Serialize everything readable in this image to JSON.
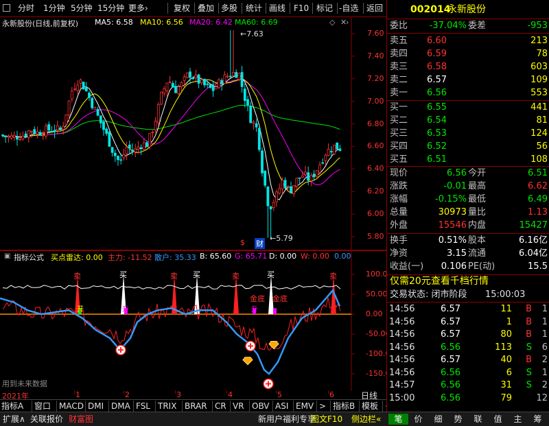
{
  "toolbar": {
    "left": [
      "分时",
      "1分钟",
      "5分钟",
      "15分钟",
      "更多›"
    ],
    "right": [
      "复权",
      "叠加",
      "多股",
      "统计",
      "画线",
      "F10",
      "标记",
      "-自选",
      "返回"
    ]
  },
  "main": {
    "title": "永新股份(日线,前复权)",
    "ma5": "MA5: 6.58",
    "ma10": "MA10: 6.56",
    "ma20": "MA20: 6.42",
    "ma60": "MA60: 6.69",
    "y_ticks": [
      "7.60",
      "7.40",
      "7.20",
      "7.00",
      "6.80",
      "6.60",
      "6.40",
      "6.20",
      "6.00",
      "5.80"
    ],
    "high_mark": "7.63",
    "low_mark": "5.79",
    "cai_label": "财",
    "dollar_label": "$"
  },
  "indicator": {
    "name": "指标公式",
    "buy_radar": "买点雷达: 0.00",
    "main_force": "主力: -11.52",
    "retail": "散户: 35.33",
    "b": "B: 65.60",
    "g": "G: 65.71",
    "d": "D: 0.00",
    "w": "W: 0.00",
    "extra": "0.00",
    "y_ticks": [
      "100.0",
      "50.00",
      "0.00",
      "-50.00",
      "-100.0",
      "-150.0"
    ],
    "marks": {
      "sell": "卖",
      "buy": "买",
      "gold_bottom": "金底",
      "kai": "开",
      "up": "升"
    },
    "future_warning": "用到未来数据"
  },
  "xaxis": {
    "year": "2021年",
    "months": [
      "1",
      "2",
      "3",
      "4",
      "5",
      "6"
    ],
    "period": "日线"
  },
  "tabs1": [
    "指标A",
    "窗口",
    "MACD",
    "DMI",
    "DMA",
    "FSL",
    "TRIX",
    "BRAR",
    "CR",
    "VR",
    "OBV",
    "ASI",
    "EMV",
    ">",
    "指标B",
    "模板",
    "+",
    "-"
  ],
  "tabs2": {
    "left": [
      "扩展∧",
      "关联报价",
      "财富图"
    ],
    "mid": [
      "新用户福利专享",
      "图文F10",
      "侧边栏«"
    ],
    "right": [
      "笔",
      "价",
      "细",
      "势",
      "联",
      "值",
      "主",
      "筹"
    ]
  },
  "quote": {
    "code": "002014",
    "name": "永新股份",
    "weibi_label": "委比",
    "weibi": "-37.04%",
    "weicha_label": "委差",
    "weicha": "-953",
    "asks": [
      {
        "label": "卖五",
        "price": "6.60",
        "vol": "213"
      },
      {
        "label": "卖四",
        "price": "6.59",
        "vol": "78"
      },
      {
        "label": "卖三",
        "price": "6.58",
        "vol": "603"
      },
      {
        "label": "卖二",
        "price": "6.57",
        "vol": "109"
      },
      {
        "label": "卖一",
        "price": "6.56",
        "vol": "553"
      }
    ],
    "bids": [
      {
        "label": "买一",
        "price": "6.55",
        "vol": "441"
      },
      {
        "label": "买二",
        "price": "6.54",
        "vol": "81"
      },
      {
        "label": "买三",
        "price": "6.53",
        "vol": "124"
      },
      {
        "label": "买四",
        "price": "6.52",
        "vol": "56"
      },
      {
        "label": "买五",
        "price": "6.51",
        "vol": "108"
      }
    ],
    "stats": [
      {
        "l1": "现价",
        "v1": "6.56",
        "l2": "今开",
        "v2": "6.51"
      },
      {
        "l1": "涨跌",
        "v1": "-0.01",
        "l2": "最高",
        "v2": "6.62"
      },
      {
        "l1": "涨幅",
        "v1": "-0.15%",
        "l2": "最低",
        "v2": "6.49"
      },
      {
        "l1": "总量",
        "v1": "30973",
        "l2": "量比",
        "v2": "1.13"
      },
      {
        "l1": "外盘",
        "v1": "15546",
        "l2": "内盘",
        "v2": "15427"
      }
    ],
    "stats2": [
      {
        "l1": "换手",
        "v1": "0.51%",
        "l2": "股本",
        "v2": "6.16亿"
      },
      {
        "l1": "净资",
        "v1": "3.15",
        "l2": "流通",
        "v2": "6.04亿"
      },
      {
        "l1": "收益(一)",
        "v1": "0.106",
        "l2": "PE(动)",
        "v2": "15.5"
      }
    ],
    "promo": "仅需20元查看千档行情",
    "status_label": "交易状态: 闭市阶段",
    "status_time": "15:00:03",
    "ticks": [
      {
        "t": "14:56",
        "p": "6.57",
        "v": "11",
        "s": "B",
        "n": "1"
      },
      {
        "t": "14:56",
        "p": "6.57",
        "v": "1",
        "s": "B",
        "n": "1"
      },
      {
        "t": "14:56",
        "p": "6.57",
        "v": "80",
        "s": "B",
        "n": "1"
      },
      {
        "t": "14:56",
        "p": "6.56",
        "v": "113",
        "s": "S",
        "n": "6"
      },
      {
        "t": "14:56",
        "p": "6.57",
        "v": "40",
        "s": "B",
        "n": "2"
      },
      {
        "t": "14:56",
        "p": "6.56",
        "v": "6",
        "s": "S",
        "n": "1"
      },
      {
        "t": "14:57",
        "p": "6.56",
        "v": "31",
        "s": "S",
        "n": "2"
      },
      {
        "t": "15:00",
        "p": "6.56",
        "v": "79",
        "s": "",
        "n": "12"
      }
    ]
  },
  "colors": {
    "up": "#ff3232",
    "down": "#00e600",
    "ma5": "#ffffff",
    "ma10": "#ffff00",
    "ma20": "#ff00ff",
    "ma60": "#00e600",
    "retail_line": "#3399ff",
    "axis": "#8b0000"
  }
}
